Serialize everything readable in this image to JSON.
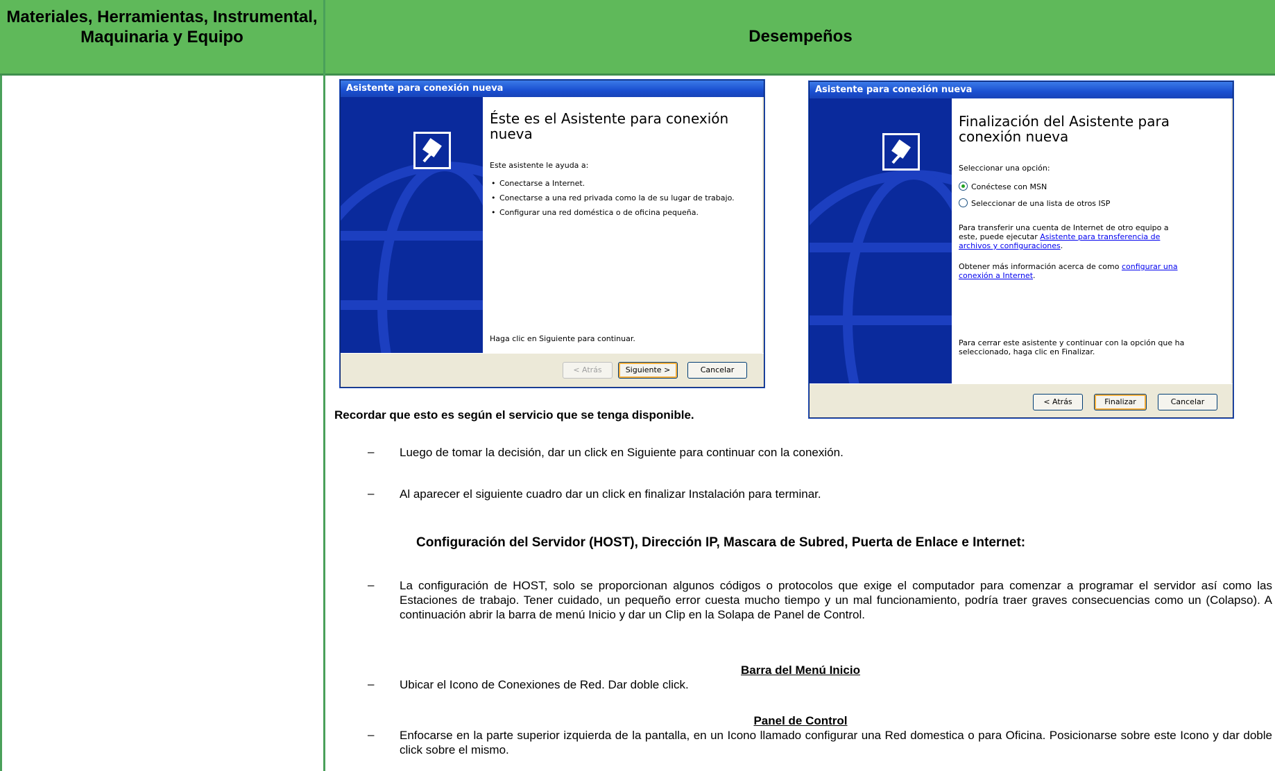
{
  "table": {
    "col1_header": "Materiales, Herramientas, Instrumental, Maquinaria y Equipo",
    "col2_header": "Desempeños"
  },
  "window1": {
    "title": "Asistente para conexión nueva",
    "heading": "Éste es el Asistente para conexión nueva",
    "intro": "Este asistente le ayuda a:",
    "bullets": [
      "Conectarse a Internet.",
      "Conectarse a una red privada como la de su lugar de trabajo.",
      "Configurar una red doméstica o de oficina pequeña."
    ],
    "footer": "Haga clic en Siguiente para continuar.",
    "buttons": {
      "back": "< Atrás",
      "next": "Siguiente >",
      "cancel": "Cancelar"
    }
  },
  "window2": {
    "title": "Asistente para conexión nueva",
    "heading": "Finalización del Asistente para conexión nueva",
    "select_label": "Seleccionar una opción:",
    "options": [
      "Conéctese con MSN",
      "Seleccionar de una lista de otros ISP"
    ],
    "transfer_text": "Para transferir una cuenta de Internet de otro equipo a este, puede ejecutar",
    "transfer_link": "Asistente para transferencia de archivos y configuraciones",
    "info_text": "Obtener más información acerca de como",
    "info_link": "configurar una conexión a Internet",
    "footer": "Para cerrar este asistente y continuar con la opción que ha seleccionado, haga clic en Finalizar.",
    "buttons": {
      "back": "< Atrás",
      "finish": "Finalizar",
      "cancel": "Cancelar"
    }
  },
  "content": {
    "caption": "Recordar que esto es según el servicio que se tenga disponible.",
    "dash": "–",
    "item1": "Luego de tomar la decisión, dar un click en Siguiente para continuar con la conexión.",
    "item2": "Al aparecer el siguiente cuadro dar un click en finalizar Instalación para terminar.",
    "section_heading": "Configuración del Servidor (HOST), Dirección IP, Mascara de Subred, Puerta de Enlace e Internet:",
    "item3": "La configuración de HOST, solo se proporcionan algunos códigos o protocolos que exige el computador para comenzar a programar el servidor así como las Estaciones de trabajo. Tener cuidado, un pequeño error cuesta mucho tiempo y un mal funcionamiento, podría traer graves consecuencias como un (Colapso). A continuación abrir la barra de menú Inicio y dar un Clip en la Solapa de Panel de Control.",
    "subhead1": "Barra del Menú Inicio",
    "item4": "Ubicar el Icono de Conexiones de Red. Dar doble click.",
    "subhead2": "Panel de Control",
    "item5": "Enfocarse en la parte superior izquierda de la pantalla, en un Icono llamado configurar una Red domestica o para Oficina. Posicionarse sobre este Icono y dar doble click sobre el mismo."
  }
}
